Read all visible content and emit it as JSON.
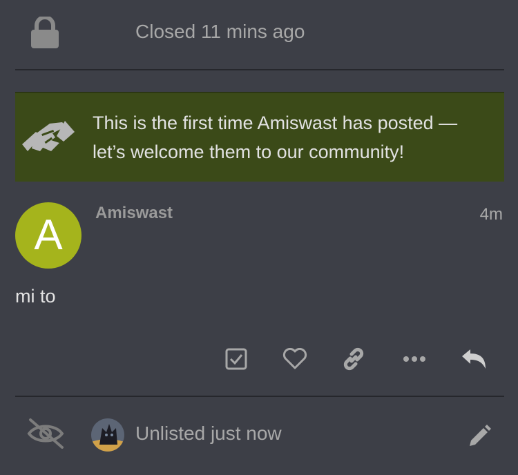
{
  "closed_event": {
    "icon": "lock-icon",
    "text": "Closed 11 mins ago"
  },
  "welcome_banner": {
    "icon": "handshake-icon",
    "text": "This is the first time Amiswast has posted — let’s welcome them to our community!",
    "background": "#3b4a18"
  },
  "post": {
    "avatar_letter": "A",
    "avatar_color": "#a5b41c",
    "username": "Amiswast",
    "time": "4m",
    "body": "mi to",
    "actions": [
      {
        "icon": "checkbox-icon",
        "name": "solution-button"
      },
      {
        "icon": "heart-icon",
        "name": "like-button"
      },
      {
        "icon": "link-icon",
        "name": "share-link-button"
      },
      {
        "icon": "more-icon",
        "name": "more-actions-button"
      },
      {
        "icon": "reply-icon",
        "name": "reply-button"
      }
    ]
  },
  "unlisted_event": {
    "icon": "eye-slash-icon",
    "text": "Unlisted just now",
    "edit_icon": "pencil-icon"
  }
}
